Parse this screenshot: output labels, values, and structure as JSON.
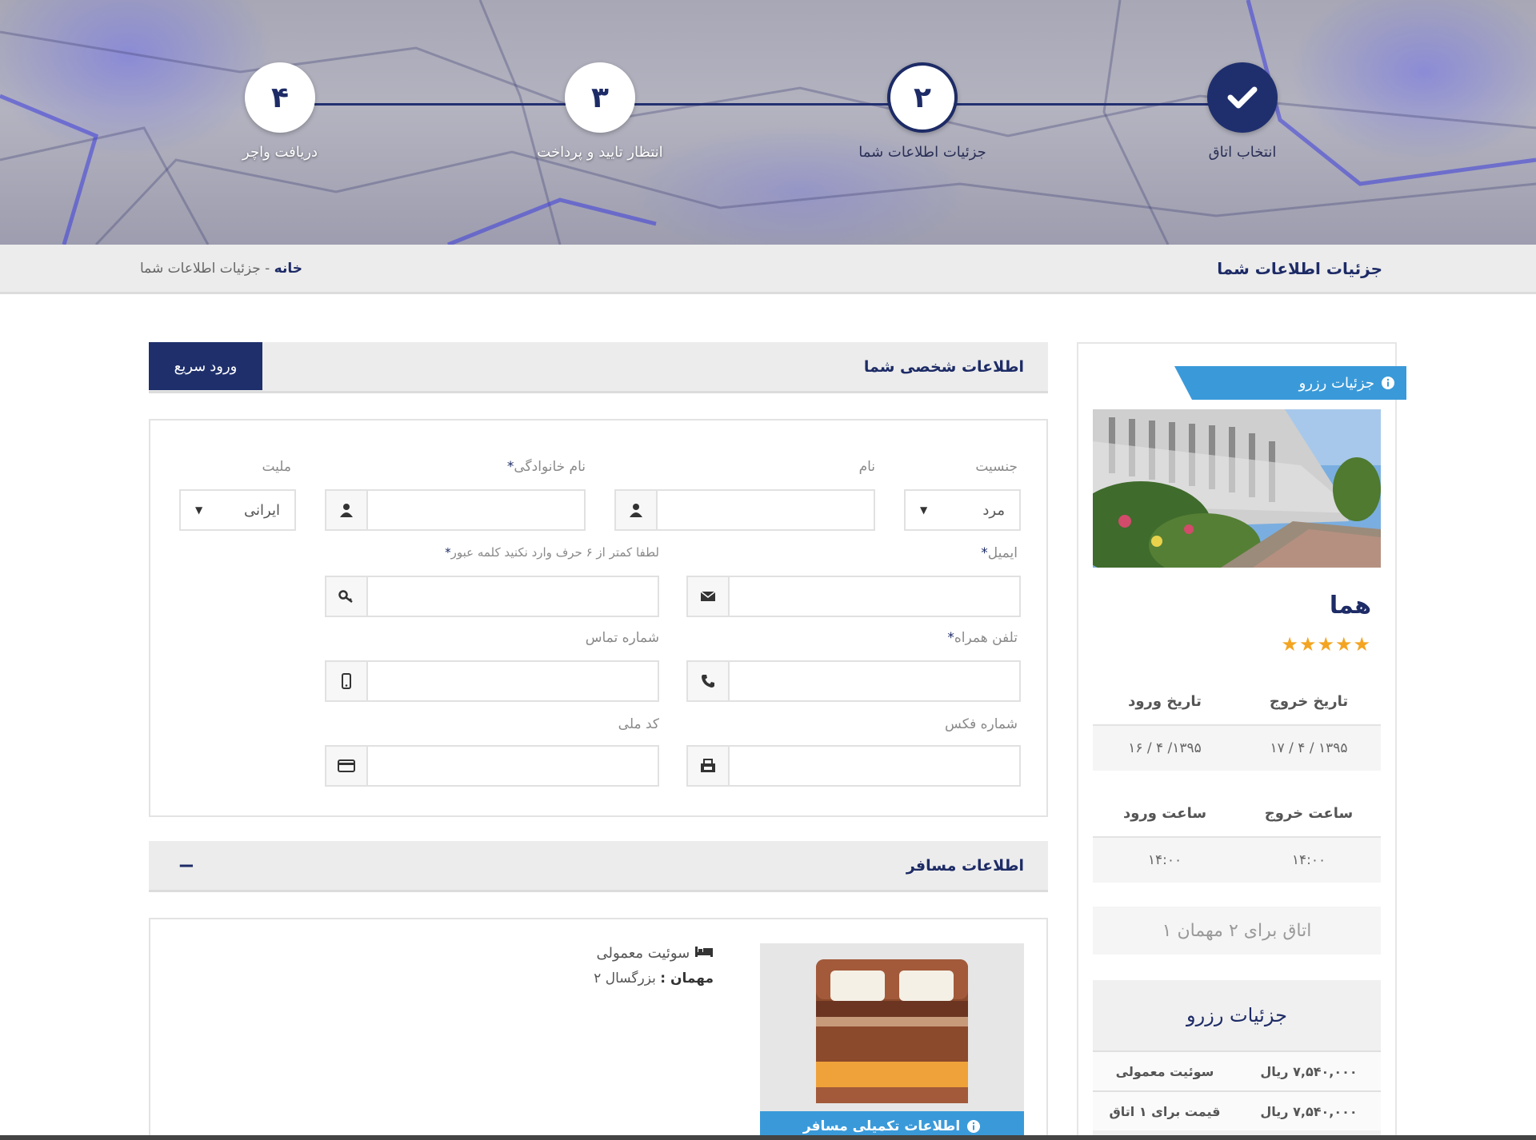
{
  "steps": [
    {
      "label": "انتخاب اتاق",
      "state": "done",
      "icon": "check-icon"
    },
    {
      "label": "جزئیات اطلاعات شما",
      "number": "۲",
      "state": "active"
    },
    {
      "label": "انتظار تایید و پرداخت",
      "number": "۳",
      "state": "pending"
    },
    {
      "label": "دریافت واچر",
      "number": "۴",
      "state": "pending"
    }
  ],
  "header": {
    "page_title": "جزئیات اطلاعات شما",
    "breadcrumb_home": "خانه",
    "breadcrumb_sep": " - ",
    "breadcrumb_current": "جزئیات اطلاعات شما"
  },
  "personal": {
    "title": "اطلاعات شخصی شما",
    "quick_login": "ورود سریع",
    "gender_label": "جنسیت",
    "gender_value": "مرد",
    "first_name_label": "نام",
    "last_name_label": "نام خانوادگی",
    "nationality_label": "ملیت",
    "nationality_value": "ایرانی",
    "email_label": "ایمیل",
    "password_hint": "لطفا کمتر از ۶ حرف وارد نکنید کلمه عبور",
    "mobile_label": "تلفن همراه",
    "phone_label": "شماره تماس",
    "fax_label": "شماره فکس",
    "national_code_label": "کد ملی",
    "required_mark": "*"
  },
  "traveller": {
    "title": "اطلاعات مسافر",
    "collapse": "−",
    "room_type": "سوئیت معمولی",
    "guests_label": "مهمان :",
    "guests_value": "بزرگسال ۲",
    "more_info_button": "اطلاعات تکمیلی مسافر"
  },
  "sidebar": {
    "ribbon": "جزئیات رزرو",
    "hotel_name": "هما",
    "stars": "★★★★★",
    "star_count": 5,
    "checkin_date_label": "تاریخ ورود",
    "checkout_date_label": "تاریخ خروج",
    "checkin_date": "۱۳۹۵/ ۴ / ۱۶",
    "checkout_date": "۱۳۹۵ / ۴ / ۱۷",
    "checkin_time_label": "ساعت ورود",
    "checkout_time_label": "ساعت خروج",
    "checkin_time": "۱۴:۰۰",
    "checkout_time": "۱۴:۰۰",
    "room_for": "اتاق برای ۲ مهمان ۱",
    "booking_title": "جزئیات رزرو",
    "rows": [
      {
        "name": "سوئیت معمولی",
        "price": "۷,۵۴۰,۰۰۰ ریال"
      },
      {
        "name": "قیمت برای ۱ اتاق",
        "price": "۷,۵۴۰,۰۰۰ ریال"
      }
    ]
  },
  "colors": {
    "brand_navy": "#1d2b66",
    "accent_blue": "#3a9ad9",
    "star_orange": "#f3a421"
  }
}
